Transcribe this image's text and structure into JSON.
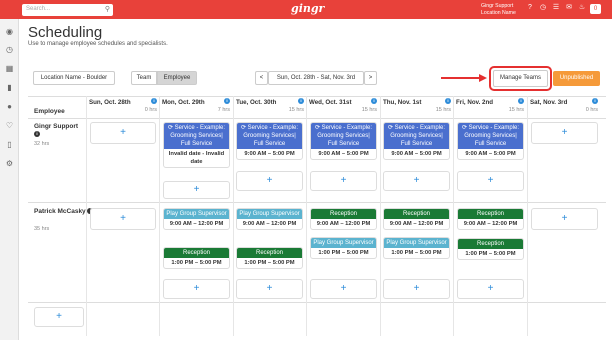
{
  "topbar": {
    "search_placeholder": "Search...",
    "logo": "gingr",
    "user_name": "Gingr Support",
    "user_location": "Location Name",
    "notification_count": "0"
  },
  "header": {
    "title": "Scheduling",
    "subtitle": "Use to manage employee schedules and specialists."
  },
  "toolbar": {
    "location": "Location Name - Boulder",
    "team": "Team",
    "employee": "Employee",
    "prev": "<",
    "date_range": "Sun, Oct. 28th - Sat, Nov. 3rd",
    "next": ">",
    "manage_teams": "Manage Teams",
    "unpublished": "Unpublished"
  },
  "grid": {
    "employee_header": "Employee",
    "days": [
      {
        "name": "Sun, Oct. 28th",
        "hrs": "0 hrs"
      },
      {
        "name": "Mon, Oct. 29th",
        "hrs": "7 hrs"
      },
      {
        "name": "Tue, Oct. 30th",
        "hrs": "15 hrs"
      },
      {
        "name": "Wed, Oct. 31st",
        "hrs": "15 hrs"
      },
      {
        "name": "Thu, Nov. 1st",
        "hrs": "15 hrs"
      },
      {
        "name": "Fri, Nov. 2nd",
        "hrs": "15 hrs"
      },
      {
        "name": "Sat, Nov. 3rd",
        "hrs": "0 hrs"
      }
    ],
    "employees": [
      {
        "name": "Gingr Support",
        "hrs": "32 hrs"
      },
      {
        "name": "Patrick McCasky",
        "hrs": "35 hrs"
      }
    ],
    "info_glyph": "i",
    "add_glyph": "+",
    "shifts": {
      "service_title": "⟳ Service - Example: Grooming Services| Full Service",
      "invalid_date": "Invalid date - Invalid date",
      "time_9_5": "9:00 AM – 5:00 PM",
      "play_group": "Play Group Supervisor",
      "reception": "Reception",
      "time_9_12": "9:00 AM – 12:00 PM",
      "time_1_5": "1:00 PM – 5:00 PM"
    }
  }
}
